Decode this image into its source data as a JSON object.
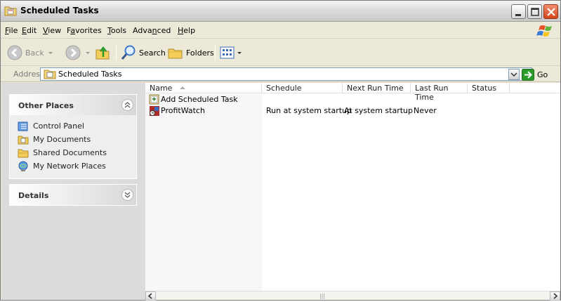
{
  "window": {
    "title": "Scheduled Tasks"
  },
  "menu": {
    "items": [
      {
        "pre": "",
        "ul": "F",
        "post": "ile"
      },
      {
        "pre": "",
        "ul": "E",
        "post": "dit"
      },
      {
        "pre": "",
        "ul": "V",
        "post": "iew"
      },
      {
        "pre": "F",
        "ul": "a",
        "post": "vorites"
      },
      {
        "pre": "",
        "ul": "T",
        "post": "ools"
      },
      {
        "pre": "Adva",
        "ul": "n",
        "post": "ced"
      },
      {
        "pre": "",
        "ul": "H",
        "post": "elp"
      }
    ]
  },
  "toolbar": {
    "back_label": "Back",
    "search_label": "Search",
    "folders_label": "Folders"
  },
  "address": {
    "label": "Address",
    "value": "Scheduled Tasks",
    "go_label": "Go"
  },
  "left": {
    "other_places": {
      "title": "Other Places",
      "items": [
        {
          "label": "Control Panel",
          "icon": "control-panel-icon"
        },
        {
          "label": "My Documents",
          "icon": "my-documents-icon"
        },
        {
          "label": "Shared Documents",
          "icon": "shared-documents-icon"
        },
        {
          "label": "My Network Places",
          "icon": "network-places-icon"
        }
      ]
    },
    "details": {
      "title": "Details"
    }
  },
  "list": {
    "columns": [
      "Name",
      "Schedule",
      "Next Run Time",
      "Last Run Time",
      "Status"
    ],
    "rows": [
      {
        "name": "Add Scheduled Task",
        "schedule": "",
        "next": "",
        "last": "",
        "status": ""
      },
      {
        "name": "ProfitWatch",
        "schedule": "Run at system startup",
        "next": "At system startup",
        "last": "Never",
        "status": ""
      }
    ]
  },
  "colors": {
    "left_pane_bg": "#dcdcdc",
    "close_button": "#d4431c",
    "go_arrow": "#2a9a2a"
  }
}
